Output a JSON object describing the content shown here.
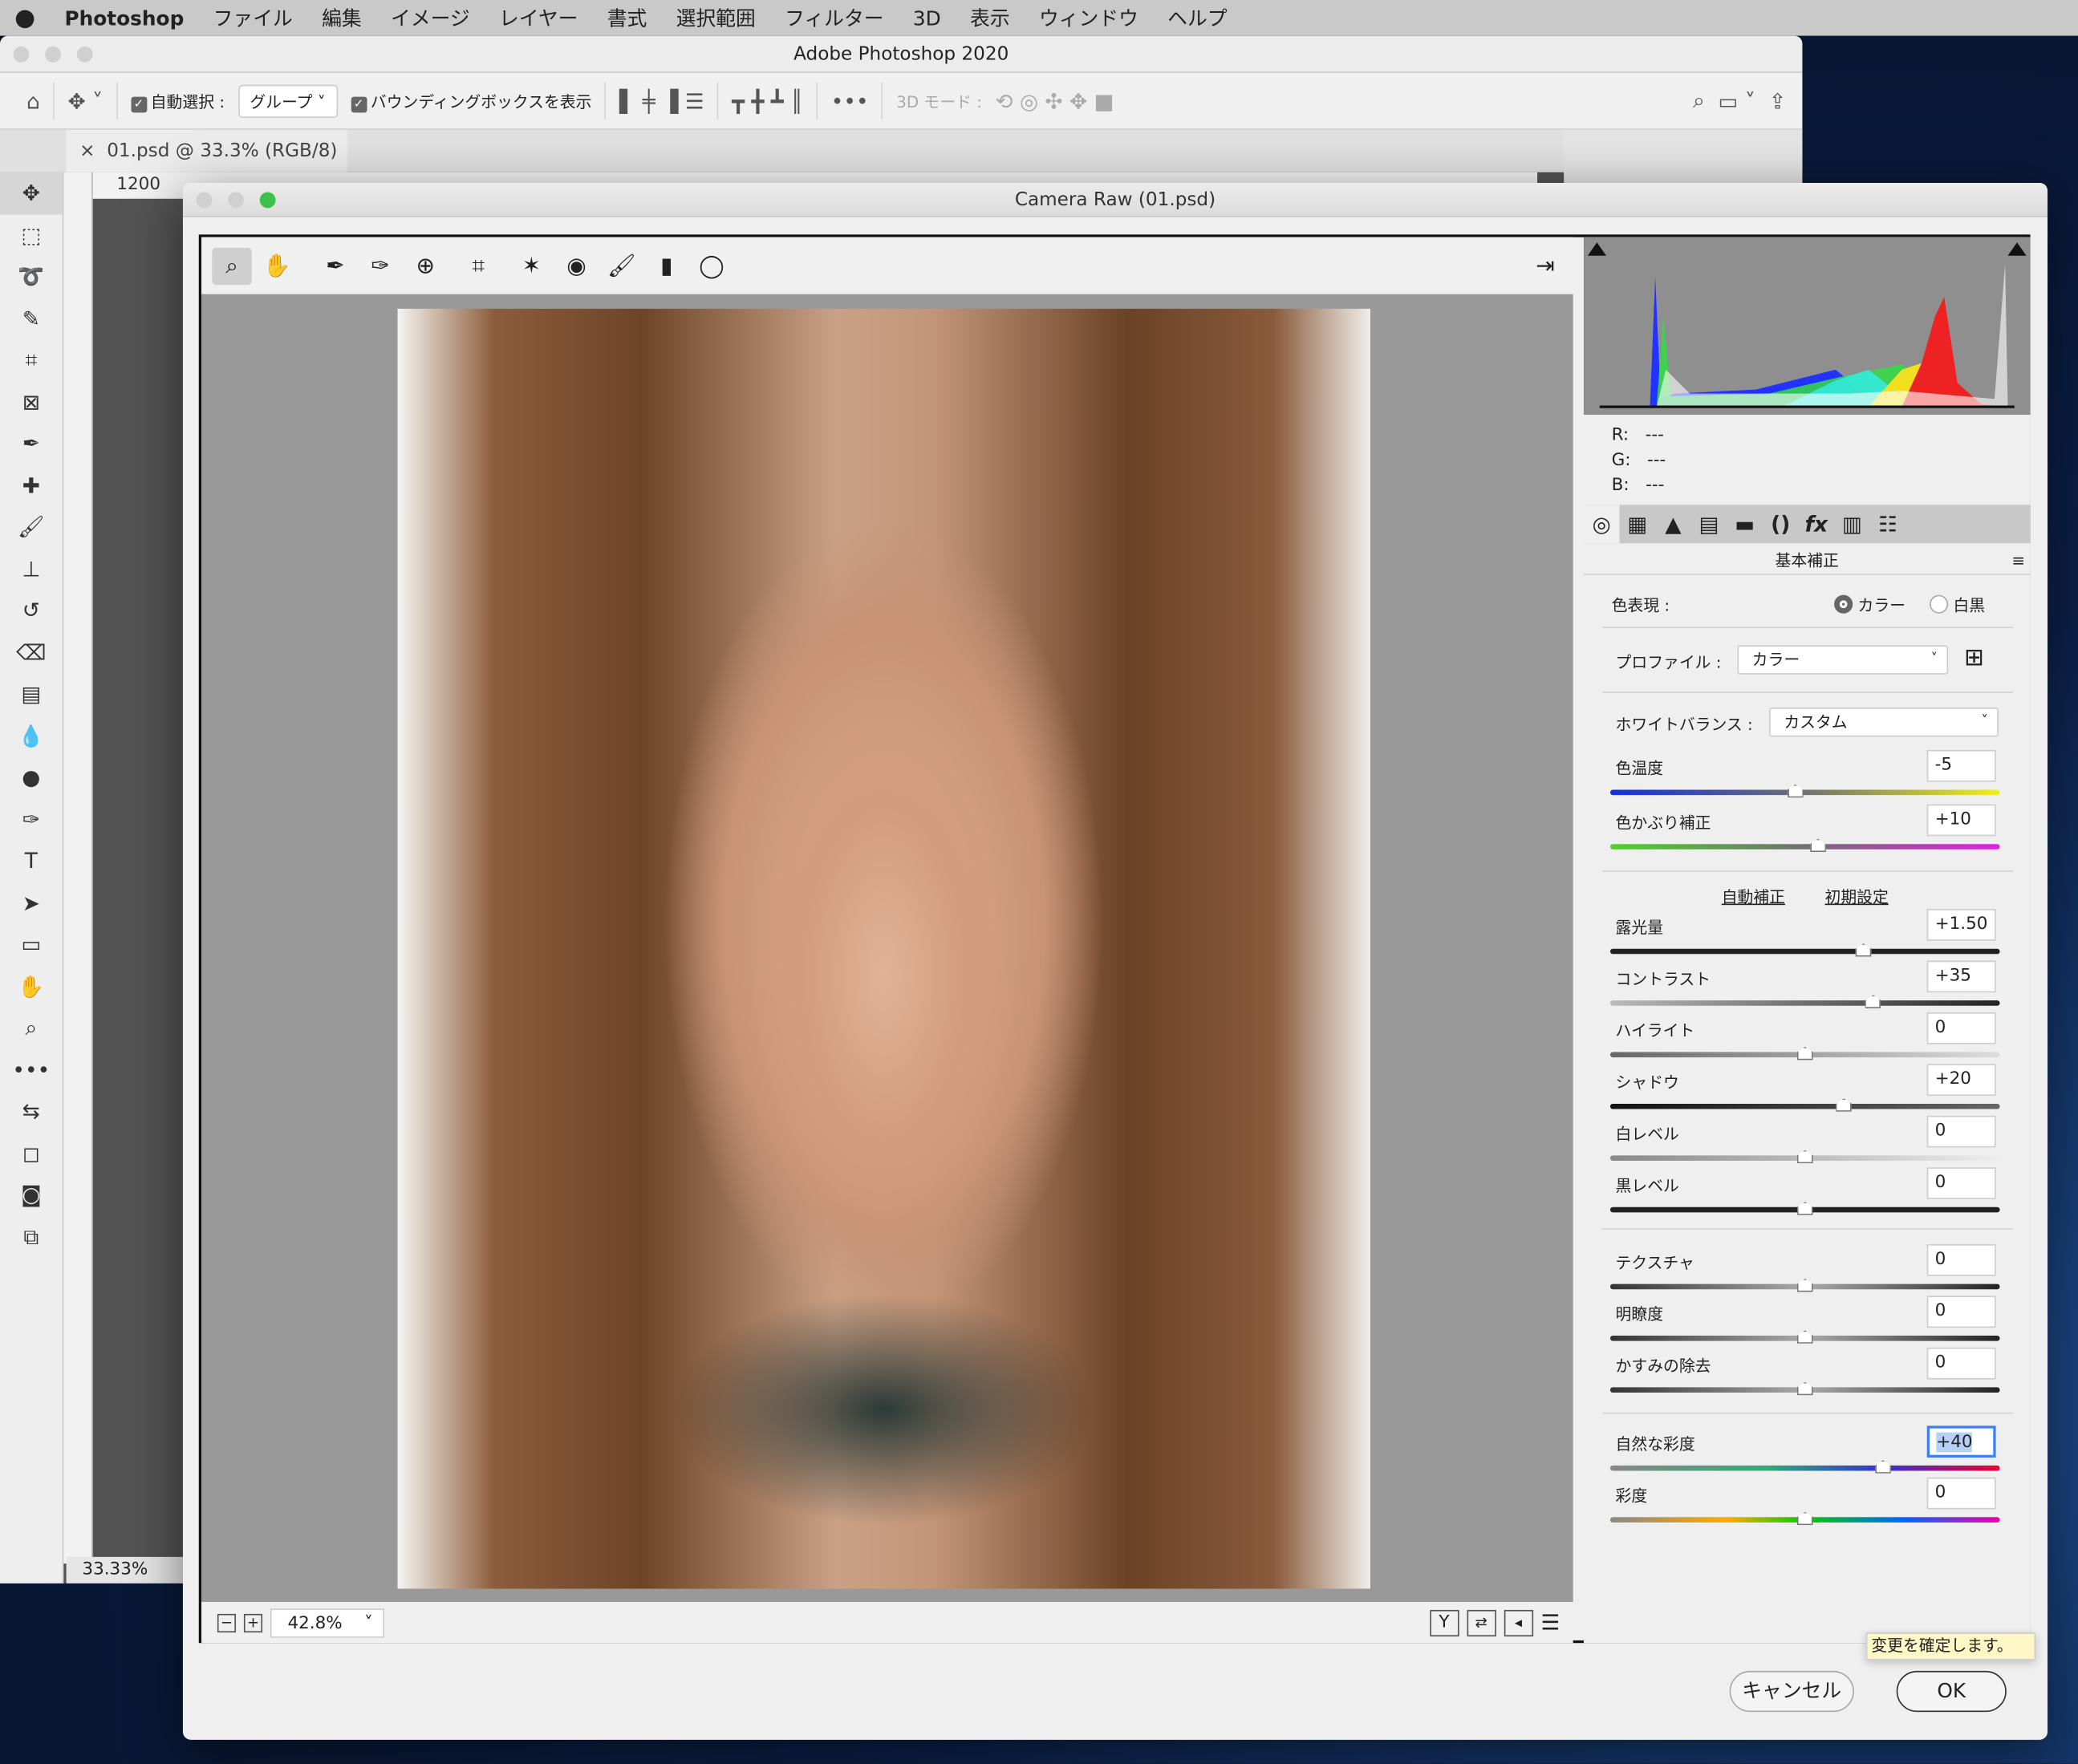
{
  "menubar": {
    "app": "Photoshop",
    "items": [
      "ファイル",
      "編集",
      "イメージ",
      "レイヤー",
      "書式",
      "選択範囲",
      "フィルター",
      "3D",
      "表示",
      "ウィンドウ",
      "ヘルプ"
    ]
  },
  "ps": {
    "window_title": "Adobe Photoshop 2020",
    "options": {
      "auto_select_label": "自動選択 :",
      "auto_select_value": "グループ",
      "bbox_label": "バウンディングボックスを表示",
      "mode3d_label": "3D モード :"
    },
    "doc_tab": "01.psd @ 33.3% (RGB/8)",
    "ruler_value": "1200",
    "zoom": "33.33%"
  },
  "cr": {
    "title": "Camera Raw (01.psd)",
    "zoom": "42.8%",
    "rgb": {
      "r_label": "R:",
      "r": "---",
      "g_label": "G:",
      "g": "---",
      "b_label": "B:",
      "b": "---"
    },
    "panel_title": "基本補正",
    "treatment": {
      "label": "色表現 :",
      "color": "カラー",
      "bw": "白黒",
      "selected": "color"
    },
    "profile": {
      "label": "プロファイル :",
      "value": "カラー"
    },
    "wb": {
      "label": "ホワイトバランス :",
      "value": "カスタム"
    },
    "auto_label": "自動補正",
    "default_label": "初期設定",
    "sliders": [
      {
        "label": "色温度",
        "value": "-5",
        "num": -5,
        "min": -100,
        "max": 100,
        "track": "linear-gradient(90deg,#1030e0,#707070 50%,#f0f020)"
      },
      {
        "label": "色かぶり補正",
        "value": "+10",
        "num": 10,
        "min": -150,
        "max": 150,
        "track": "linear-gradient(90deg,#50d030,#707070 50%,#e020e0)"
      },
      {
        "label": "露光量",
        "value": "+1.50",
        "num": 1.5,
        "min": -5,
        "max": 5,
        "track": "#222"
      },
      {
        "label": "コントラスト",
        "value": "+35",
        "num": 35,
        "min": -100,
        "max": 100,
        "track": "linear-gradient(90deg,#bbb,#222)"
      },
      {
        "label": "ハイライト",
        "value": "0",
        "num": 0,
        "min": -100,
        "max": 100,
        "track": "linear-gradient(90deg,#666,#ddd)"
      },
      {
        "label": "シャドウ",
        "value": "+20",
        "num": 20,
        "min": -100,
        "max": 100,
        "track": "linear-gradient(90deg,#111,#666)"
      },
      {
        "label": "白レベル",
        "value": "0",
        "num": 0,
        "min": -100,
        "max": 100,
        "track": "linear-gradient(90deg,#888,#eee)"
      },
      {
        "label": "黒レベル",
        "value": "0",
        "num": 0,
        "min": -100,
        "max": 100,
        "track": "#222"
      },
      {
        "label": "テクスチャ",
        "value": "0",
        "num": 0,
        "min": -100,
        "max": 100,
        "track": "linear-gradient(90deg,#333,#aaa 50%,#222)"
      },
      {
        "label": "明瞭度",
        "value": "0",
        "num": 0,
        "min": -100,
        "max": 100,
        "track": "linear-gradient(90deg,#333,#aaa 50%,#222)"
      },
      {
        "label": "かすみの除去",
        "value": "0",
        "num": 0,
        "min": -100,
        "max": 100,
        "track": "linear-gradient(90deg,#333,#aaa 50%,#222)"
      },
      {
        "label": "自然な彩度",
        "value": "+40",
        "num": 40,
        "min": -100,
        "max": 100,
        "track": "linear-gradient(90deg,#888,#3a7 40%,#33c 70%,#e03 100%)",
        "focused": true
      },
      {
        "label": "彩度",
        "value": "0",
        "num": 0,
        "min": -100,
        "max": 100,
        "track": "linear-gradient(90deg,#888,#fa0 30%,#0c0 50%,#06f 75%,#e0a)"
      }
    ],
    "tooltip": "変更を確定します。",
    "cancel": "キャンセル",
    "ok": "OK"
  }
}
